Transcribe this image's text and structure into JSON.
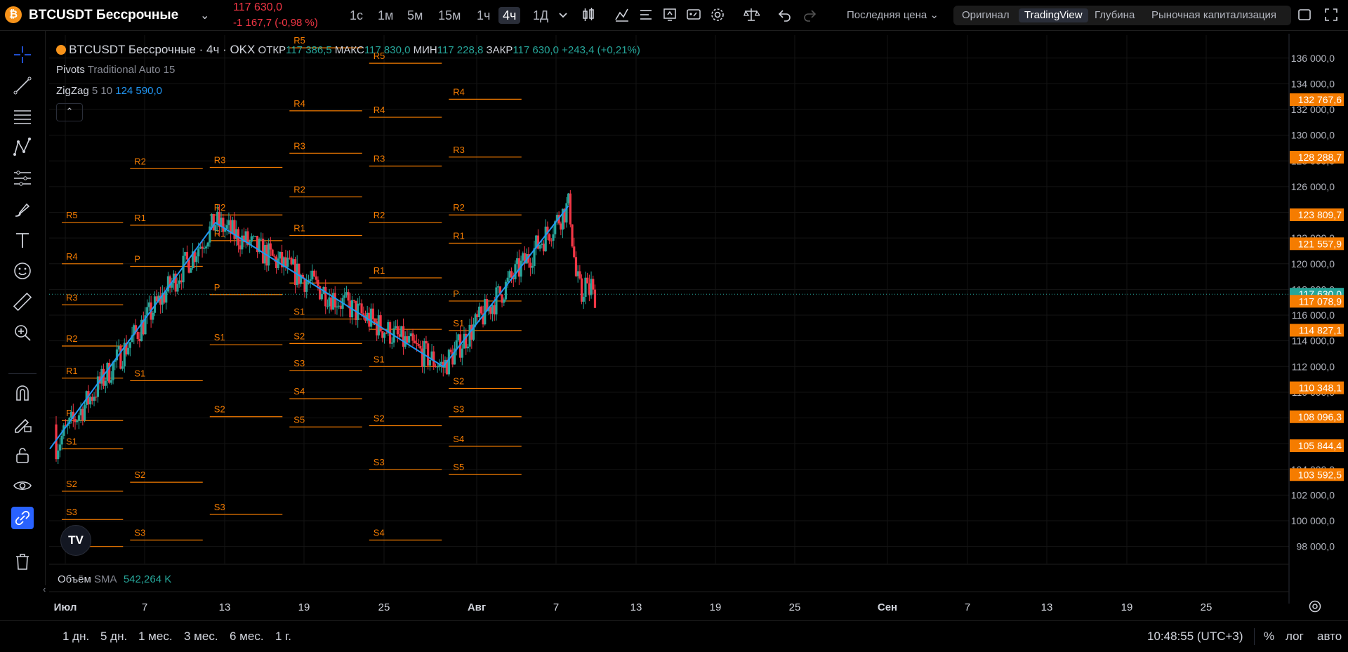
{
  "header": {
    "symbol": "BTCUSDT Бессрочные",
    "last_price": "117 630,0",
    "change": "-1 167,7 (-0,98 %)",
    "intervals": [
      "1с",
      "1м",
      "5м",
      "15м",
      "1ч",
      "4ч",
      "1Д"
    ],
    "active_interval": "4ч",
    "price_source": "Последняя цена",
    "views": [
      "Оригинал",
      "TradingView",
      "Глубина",
      "Рыночная капитализация"
    ],
    "active_view": "TradingView"
  },
  "legend": {
    "title": "BTCUSDT Бессрочные · 4ч · OKX",
    "open_label": "ОТКР",
    "open": "117 386,5",
    "high_label": "МАКС",
    "high": "117 830,0",
    "low_label": "МИН",
    "low": "117 228,8",
    "close_label": "ЗАКР",
    "close": "117 630,0",
    "change": "+243,4 (+0,21%)",
    "pivots_name": "Pivots",
    "pivots_params": "Traditional Auto 15",
    "zigzag_name": "ZigZag",
    "zigzag_params": "5 10",
    "zigzag_value": "124 590,0"
  },
  "volume": {
    "label": "Объём",
    "ma": "SMA",
    "value": "542,264 K"
  },
  "bottom": {
    "ranges": [
      "1 дн.",
      "5 дн.",
      "1 мес.",
      "3 мес.",
      "6 мес.",
      "1 г."
    ],
    "time": "10:48:55 (UTC+3)",
    "percent": "%",
    "log": "лог",
    "auto": "авто"
  },
  "colors": {
    "up": "#26a69a",
    "down": "#f23645",
    "pivot": "#f57c00",
    "zigzag": "#2196f3",
    "price_badge": "#26a69a",
    "level_badge": "#f57c00"
  },
  "chart_data": {
    "type": "candlestick",
    "y_axis_ticks": [
      "136 000,0",
      "134 000,0",
      "132 000,0",
      "130 000,0",
      "128 000,0",
      "126 000,0",
      "124 000,0",
      "122 000,0",
      "120 000,0",
      "118 000,0",
      "116 000,0",
      "114 000,0",
      "112 000,0",
      "110 000,0",
      "108 000,0",
      "106 000,0",
      "104 000,0",
      "102 000,0",
      "100 000,0",
      "98 000,0"
    ],
    "ylim": [
      97000,
      137300
    ],
    "x_axis_ticks": [
      "Июл",
      "7",
      "13",
      "19",
      "25",
      "Авг",
      "7",
      "13",
      "19",
      "25",
      "Сен",
      "7",
      "13",
      "19",
      "25"
    ],
    "price_badges": [
      {
        "label": "132 767,6",
        "value": 132767.6
      },
      {
        "label": "128 288,7",
        "value": 128288.7
      },
      {
        "label": "123 809,7",
        "value": 123809.7
      },
      {
        "label": "121 557,9",
        "value": 121557.9
      },
      {
        "label": "117 630,0",
        "value": 117630.0,
        "current": true
      },
      {
        "label": "117 078,9",
        "value": 117078.9
      },
      {
        "label": "114 827,1",
        "value": 114827.1
      },
      {
        "label": "110 348,1",
        "value": 110348.1
      },
      {
        "label": "108 096,3",
        "value": 108096.3
      },
      {
        "label": "105 844,4",
        "value": 105844.4
      },
      {
        "label": "103 592,5",
        "value": 103592.5
      }
    ],
    "zigzag_points": [
      {
        "date": "2025-06-30",
        "price": 105900
      },
      {
        "date": "2025-07-14",
        "price": 123200
      },
      {
        "date": "2025-08-03",
        "price": 112000
      },
      {
        "date": "2025-08-14",
        "price": 124500
      }
    ],
    "pivot_periods": [
      {
        "start": "2025-06-30",
        "end": "2025-07-06",
        "levels": {
          "R5": 123200,
          "R4": 120000,
          "R3": 116800,
          "R2": 113600,
          "R1": 111100,
          "P": 107800,
          "S1": 105600,
          "S2": 102300,
          "S3": 100100,
          "S4": 98000
        }
      },
      {
        "start": "2025-07-06",
        "end": "2025-07-13",
        "levels": {
          "R2": 127400,
          "R1": 123000,
          "P": 119800,
          "S1": 110900,
          "S2": 103000,
          "S3": 98500
        }
      },
      {
        "start": "2025-07-13",
        "end": "2025-07-20",
        "levels": {
          "R3": 127500,
          "R2": 123800,
          "R1": 121800,
          "P": 117600,
          "S1": 113700,
          "S2": 108100,
          "S3": 100500
        }
      },
      {
        "start": "2025-07-20",
        "end": "2025-07-27",
        "levels": {
          "R5": 136800,
          "R4": 131900,
          "R3": 128600,
          "R2": 125200,
          "R1": 122200,
          "P": 118500,
          "S1": 115700,
          "S2": 113800,
          "S3": 111700,
          "S4": 109500,
          "S5": 107300
        }
      },
      {
        "start": "2025-07-27",
        "end": "2025-08-03",
        "levels": {
          "R5": 135600,
          "R4": 131400,
          "R3": 127600,
          "R2": 123200,
          "R1": 118900,
          "P": 114900,
          "S1": 112000,
          "S2": 107400,
          "S3": 104000,
          "S4": 98500
        }
      },
      {
        "start": "2025-08-03",
        "end": "2025-08-10",
        "levels": {
          "R4": 132800,
          "R3": 128300,
          "R2": 123800,
          "R1": 121600,
          "P": 117100,
          "S1": 114800,
          "S2": 110300,
          "S3": 108100,
          "S4": 105800,
          "S5": 103600
        }
      }
    ]
  }
}
